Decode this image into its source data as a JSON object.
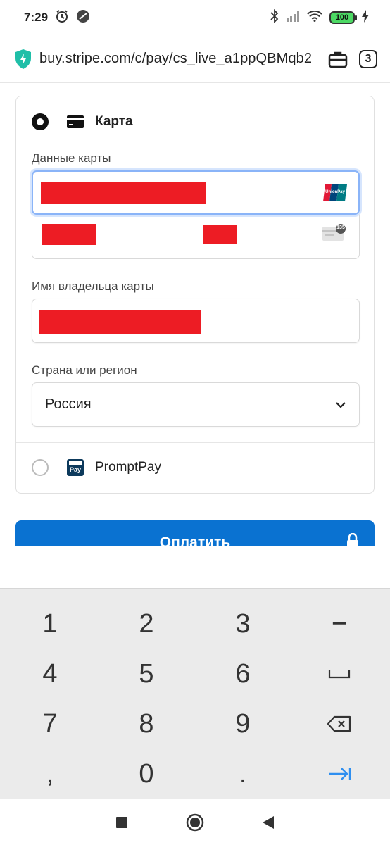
{
  "status_bar": {
    "time": "7:29",
    "battery": "100"
  },
  "browser": {
    "url": "buy.stripe.com/c/pay/cs_live_a1ppQBMqb2",
    "tab_count": "3"
  },
  "payment": {
    "card_method_label": "Карта",
    "card_data_label": "Данные карты",
    "cvc_hint": "135",
    "cardholder_label": "Имя владельца карты",
    "country_label": "Страна или регион",
    "country_value": "Россия",
    "promptpay_label": "PromptPay",
    "promptpay_icon_text": "Pay",
    "unionpay_text": "UnionPay",
    "pay_button_label": "Оплатить"
  },
  "keyboard": {
    "keys": [
      "1",
      "2",
      "3",
      "−",
      "4",
      "5",
      "6",
      "",
      "7",
      "8",
      "9",
      "",
      ",",
      "0",
      ".",
      ""
    ]
  },
  "colors": {
    "accent": "#0a72d1",
    "redaction": "#ed1c24",
    "focus": "#8ab4f8"
  }
}
